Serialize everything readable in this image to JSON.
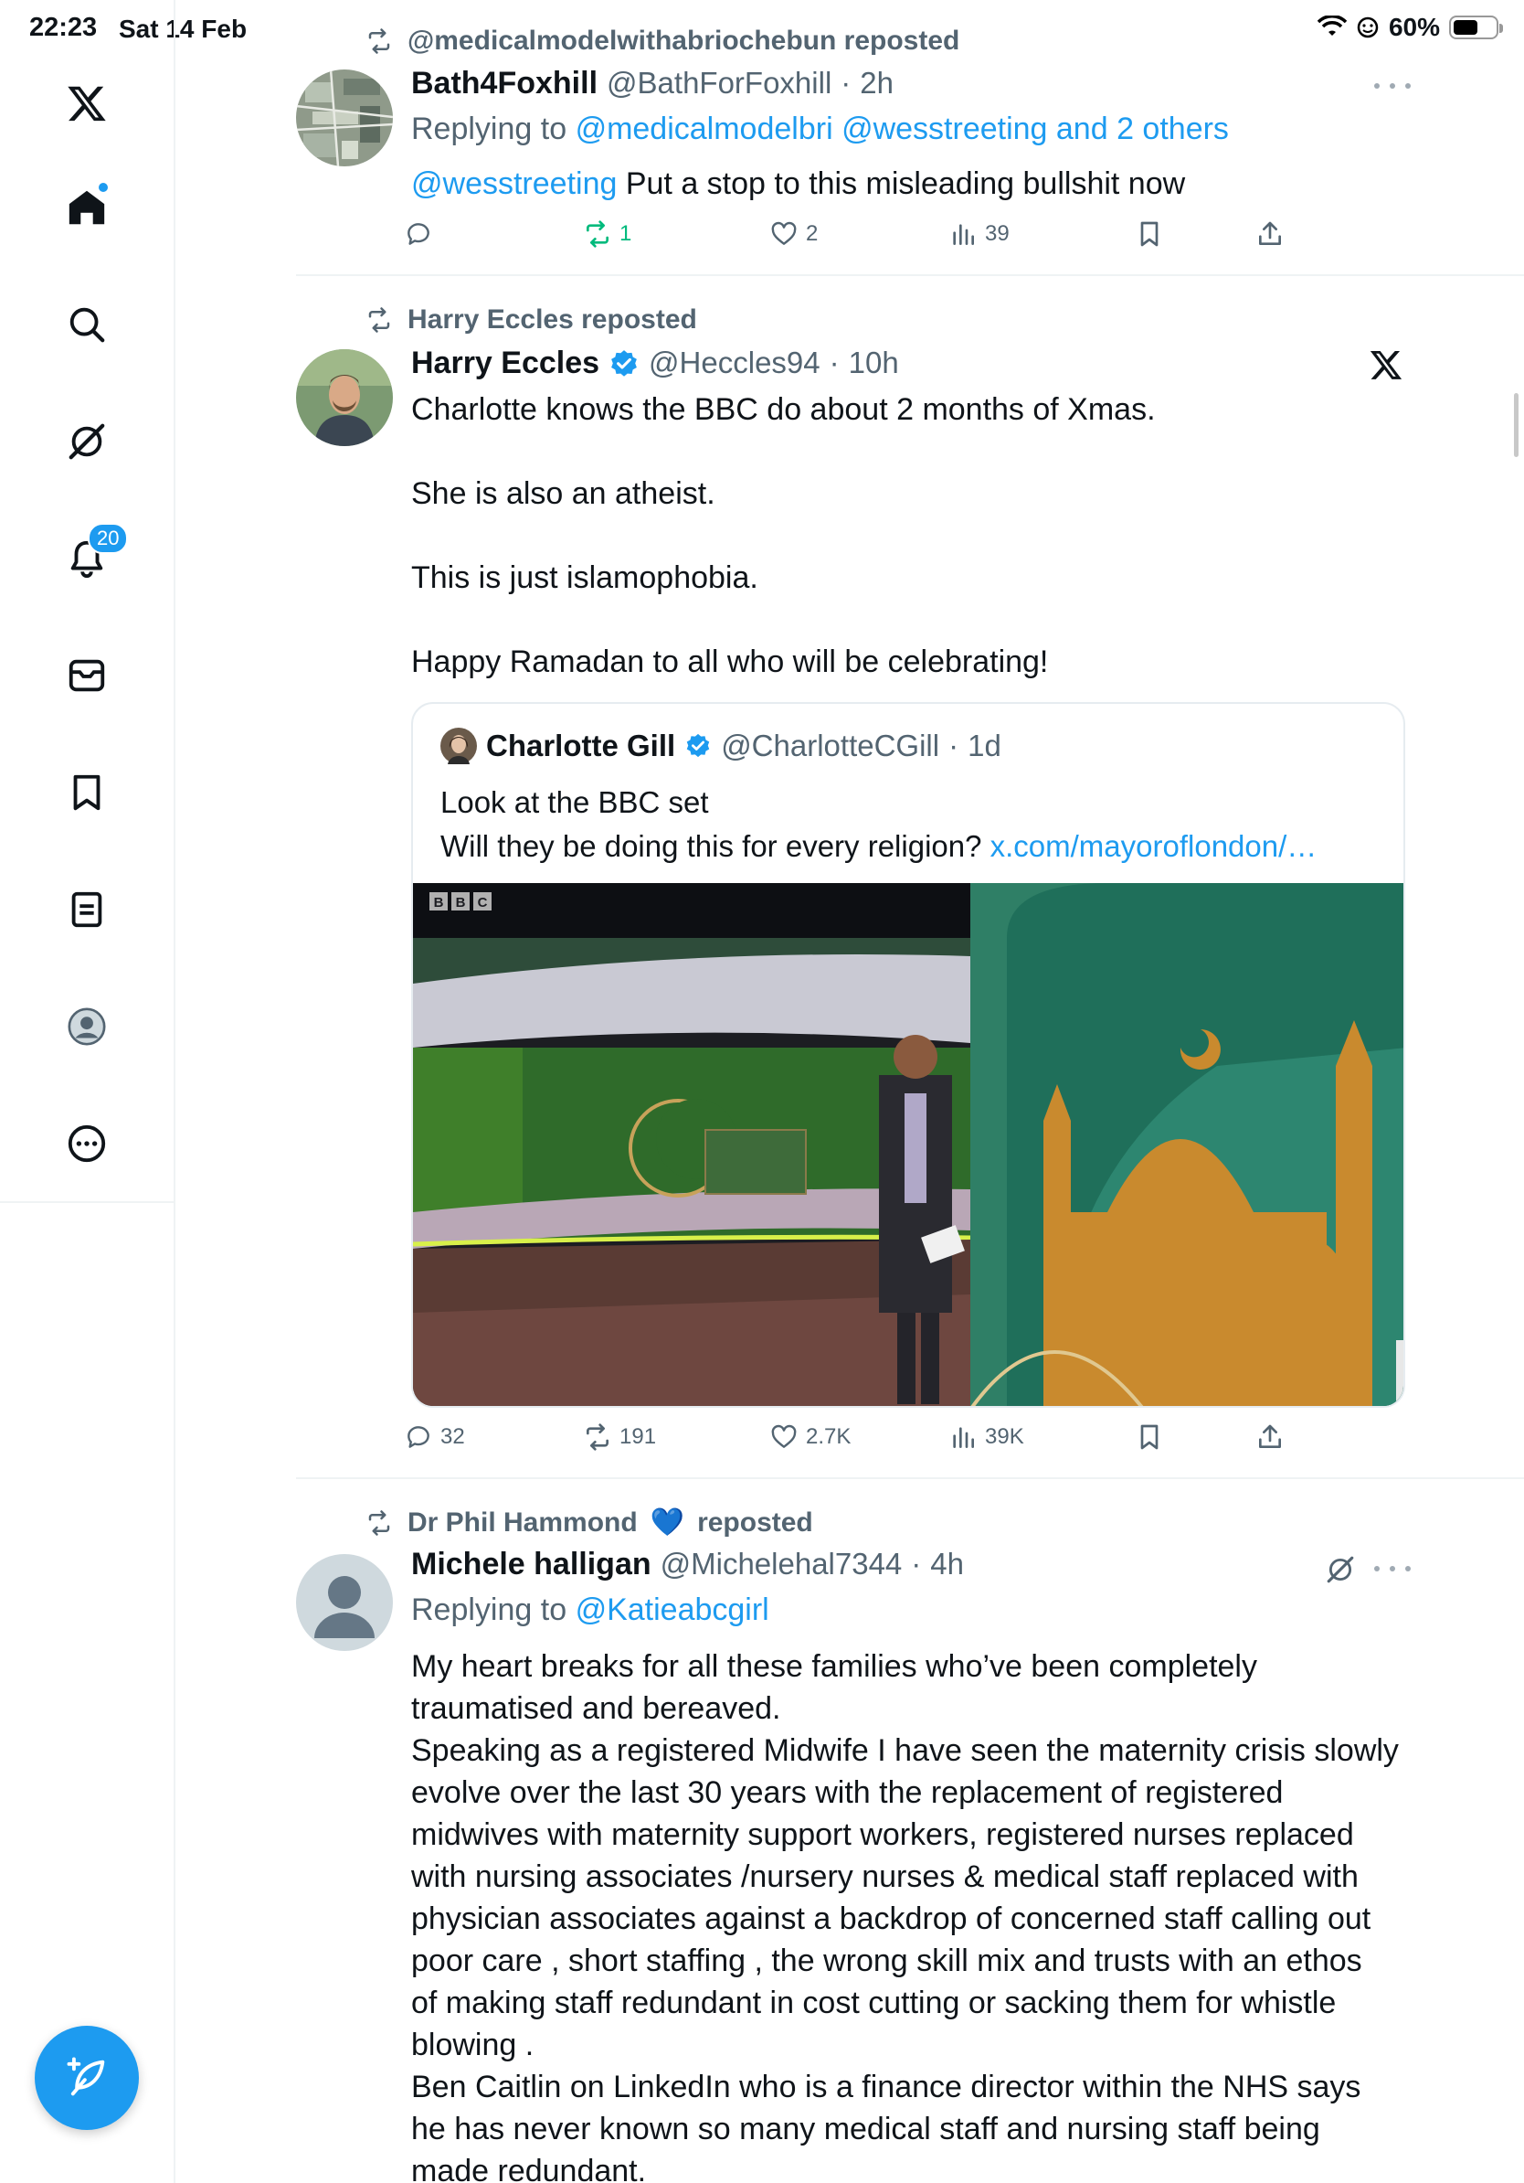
{
  "status_bar": {
    "time": "22:23",
    "date": "Sat 14 Feb",
    "battery": "60%",
    "battery_level": 0.6
  },
  "sidebar": {
    "notifications_badge": "20",
    "items": [
      {
        "icon": "x-logo-icon"
      },
      {
        "icon": "home-icon"
      },
      {
        "icon": "search-icon"
      },
      {
        "icon": "grok-icon"
      },
      {
        "icon": "notifications-icon"
      },
      {
        "icon": "messages-icon"
      },
      {
        "icon": "bookmarks-icon"
      },
      {
        "icon": "lists-icon"
      },
      {
        "icon": "profile-icon"
      },
      {
        "icon": "more-icon"
      }
    ],
    "compose_icon": "compose-icon"
  },
  "tweets": [
    {
      "repost_by": "@medicalmodelwithabriochebun reposted",
      "name": "Bath4Foxhill",
      "handle": "@BathForFoxhill",
      "sep": "·",
      "time": "2h",
      "reply_prefix": "Replying to",
      "reply_to": "@medicalmodelbri @wesstreeting and 2 others",
      "mention": "@wesstreeting",
      "text": "Put a stop to this misleading bullshit now",
      "stats": {
        "replies": "",
        "reposts": "1",
        "likes": "2",
        "views": "39"
      }
    },
    {
      "repost_by": "Harry Eccles reposted",
      "name": "Harry Eccles",
      "handle": "@Heccles94",
      "sep": "·",
      "time": "10h",
      "text_lines": [
        "Charlotte knows the BBC do about 2 months of Xmas.",
        "She is also an atheist.",
        "This is just islamophobia.",
        "Happy Ramadan to all who will be celebrating!"
      ],
      "quote": {
        "name": "Charlotte Gill",
        "handle": "@CharlotteCGill",
        "sep": "·",
        "time": "1d",
        "line1": "Look at the BBC set",
        "line2": "Will they be doing this for every religion?",
        "link": "x.com/mayoroflondon/…",
        "media_logo": "BBC"
      },
      "stats": {
        "replies": "32",
        "reposts": "191",
        "likes": "2.7K",
        "views": "39K"
      }
    },
    {
      "repost_by": "Dr Phil Hammond",
      "repost_suffix": "reposted",
      "repost_emoji": "💙",
      "name": "Michele halligan",
      "handle": "@Michelehal7344",
      "sep": "·",
      "time": "4h",
      "reply_prefix": "Replying to",
      "reply_to": "@Katieabcgirl",
      "text_lines": [
        "My heart breaks for all these families who’ve been completely",
        "traumatised and bereaved.",
        "Speaking as a registered Midwife I have seen the maternity crisis slowly",
        "evolve over the last 30 years with the replacement of registered",
        "midwives with maternity support workers,  registered nurses replaced",
        "with nursing associates /nursery nurses & medical staff replaced with",
        "physician associates against a backdrop of concerned  staff calling out",
        "poor care , short staffing , the wrong skill mix and trusts with an ethos",
        "of making staff redundant in cost cutting or sacking them for whistle",
        "blowing .",
        "Ben Caitlin on LinkedIn who is a  finance director within the NHS says",
        "he has never known so many medical staff and nursing staff being",
        "made redundant."
      ]
    }
  ]
}
